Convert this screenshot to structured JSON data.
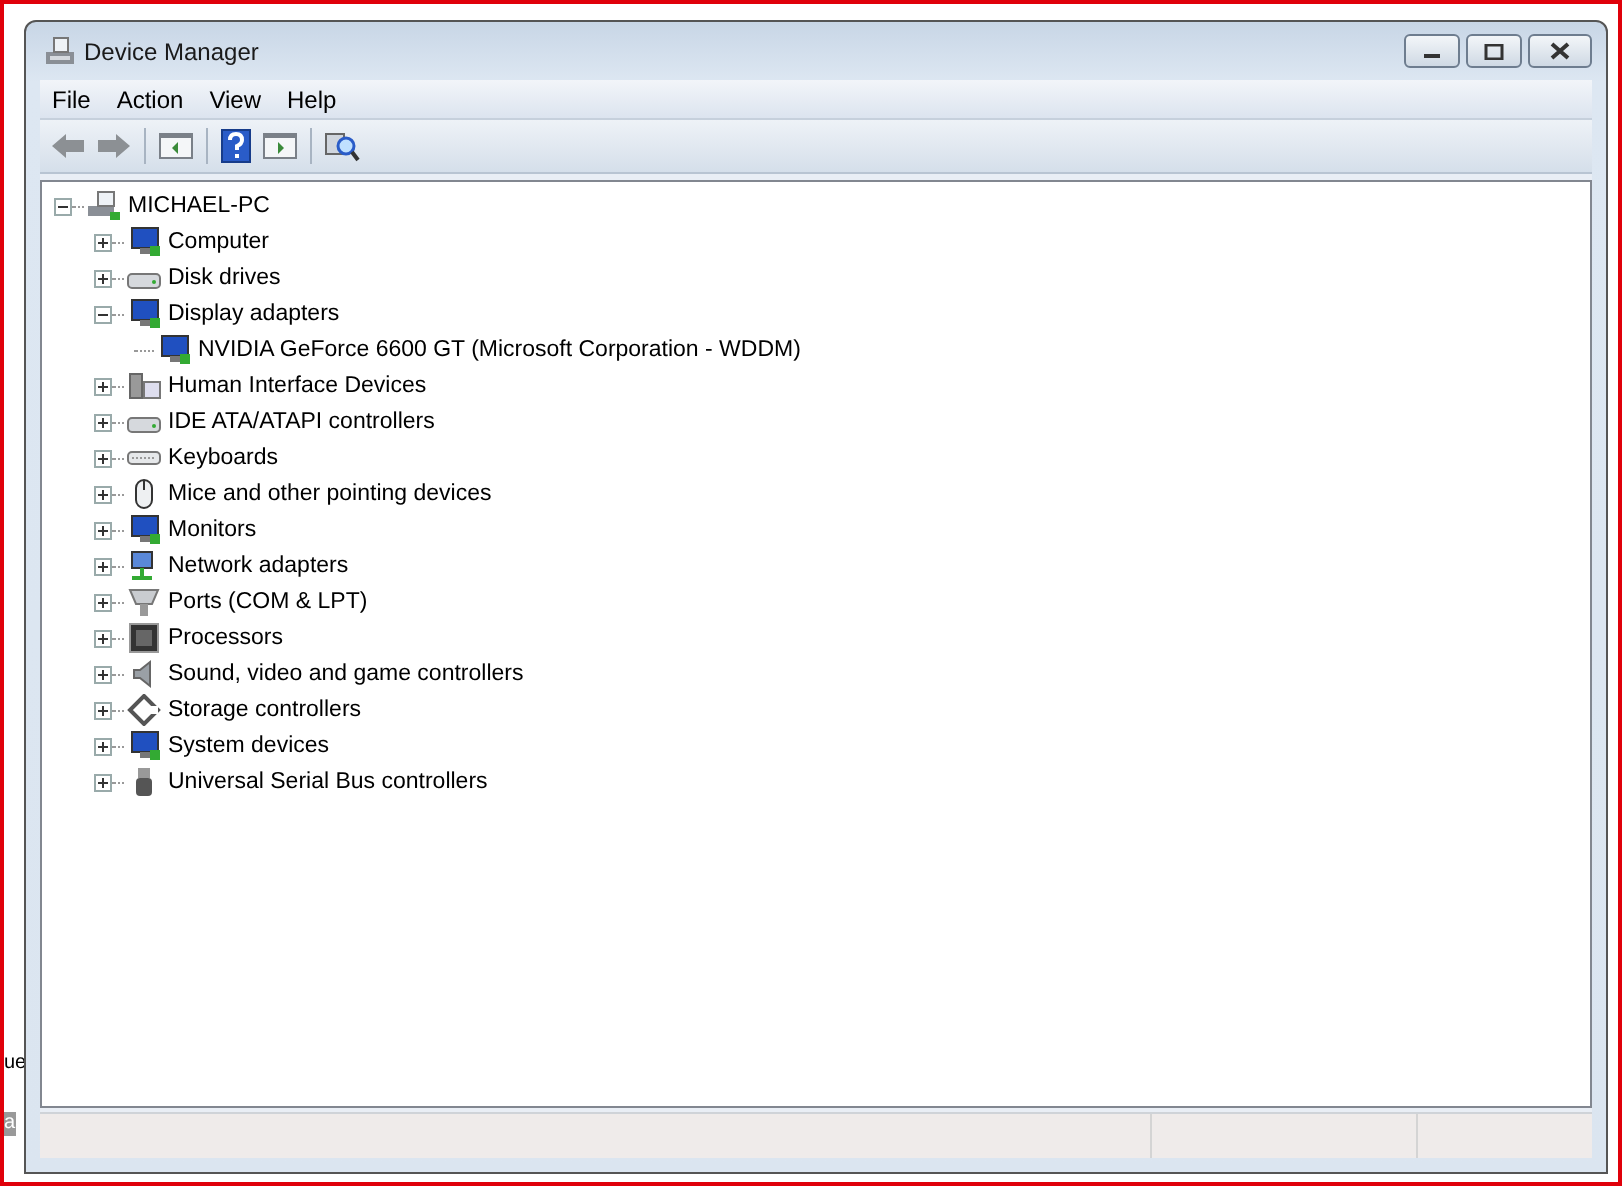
{
  "window": {
    "title": "Device Manager"
  },
  "menu": [
    {
      "label": "File"
    },
    {
      "label": "Action"
    },
    {
      "label": "View"
    },
    {
      "label": "Help"
    }
  ],
  "tree": {
    "label": "MICHAEL-PC",
    "expanded": true,
    "children": [
      {
        "label": "Computer",
        "expanded": false
      },
      {
        "label": "Disk drives",
        "expanded": false
      },
      {
        "label": "Display adapters",
        "expanded": true,
        "children": [
          {
            "label": "NVIDIA GeForce 6600 GT (Microsoft Corporation - WDDM)"
          }
        ]
      },
      {
        "label": "Human Interface Devices",
        "expanded": false
      },
      {
        "label": "IDE ATA/ATAPI controllers",
        "expanded": false
      },
      {
        "label": "Keyboards",
        "expanded": false
      },
      {
        "label": "Mice and other pointing devices",
        "expanded": false
      },
      {
        "label": "Monitors",
        "expanded": false
      },
      {
        "label": "Network adapters",
        "expanded": false
      },
      {
        "label": "Ports (COM & LPT)",
        "expanded": false
      },
      {
        "label": "Processors",
        "expanded": false
      },
      {
        "label": "Sound, video and game controllers",
        "expanded": false
      },
      {
        "label": "Storage controllers",
        "expanded": false
      },
      {
        "label": "System devices",
        "expanded": false
      },
      {
        "label": "Universal Serial Bus controllers",
        "expanded": false
      }
    ]
  },
  "background_fragments": [
    "ue",
    "a"
  ]
}
